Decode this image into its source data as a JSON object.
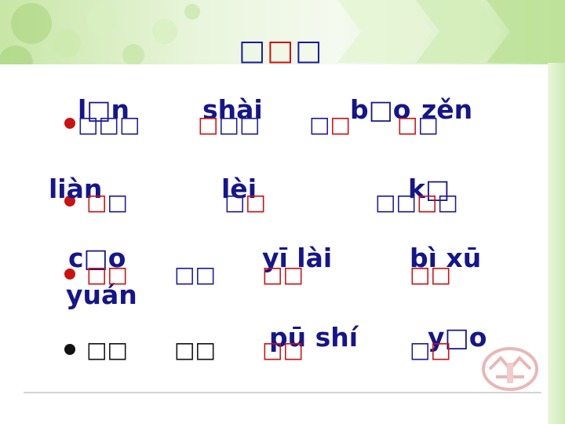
{
  "title": {
    "c1": "□",
    "c2": "□",
    "c3": "□"
  },
  "rows": [
    {
      "pinyin": [
        "l□n",
        "shài",
        "b□o",
        "zěn"
      ],
      "hanzi": [
        [
          {
            "t": "□",
            "c": "blue"
          },
          {
            "t": "□",
            "c": "blue"
          },
          {
            "t": "□",
            "c": "blue"
          }
        ],
        [
          {
            "t": "□",
            "c": "red"
          },
          {
            "t": "□",
            "c": "blue"
          },
          {
            "t": "□",
            "c": "blue"
          }
        ],
        [
          {
            "t": "□",
            "c": "blue"
          },
          {
            "t": "□",
            "c": "red"
          }
        ],
        [
          {
            "t": "□",
            "c": "red"
          },
          {
            "t": "□",
            "c": "blue"
          }
        ]
      ]
    },
    {
      "pinyin": [
        "liàn",
        "lèi",
        "k□"
      ],
      "hanzi": [
        [
          {
            "t": "□",
            "c": "red"
          },
          {
            "t": "□",
            "c": "blue"
          }
        ],
        [
          {
            "t": "□",
            "c": "blue"
          },
          {
            "t": "□",
            "c": "red"
          }
        ],
        [
          {
            "t": "□",
            "c": "blue"
          },
          {
            "t": "□",
            "c": "blue"
          },
          {
            "t": "□",
            "c": "red"
          },
          {
            "t": "□",
            "c": "blue"
          }
        ]
      ]
    },
    {
      "pinyin": [
        "c□o",
        "yuán",
        "yī lài",
        "bì xū"
      ],
      "hanzi": [
        [
          {
            "t": "□",
            "c": "red"
          },
          {
            "t": "□",
            "c": "red"
          }
        ],
        [
          {
            "t": "□",
            "c": "blue"
          },
          {
            "t": "□",
            "c": "blue"
          }
        ],
        [
          {
            "t": "□",
            "c": "red"
          },
          {
            "t": "□",
            "c": "red"
          }
        ],
        [
          {
            "t": "□",
            "c": "red"
          },
          {
            "t": "□",
            "c": "red"
          }
        ]
      ]
    },
    {
      "pinyin": [
        "pū shí",
        "y□o"
      ],
      "hanzi": [
        [
          {
            "t": "□",
            "c": "black"
          },
          {
            "t": "□",
            "c": "black"
          }
        ],
        [
          {
            "t": "□",
            "c": "black"
          },
          {
            "t": "□",
            "c": "black"
          }
        ],
        [
          {
            "t": "□",
            "c": "red"
          },
          {
            "t": "□",
            "c": "red"
          }
        ],
        [
          {
            "t": "□",
            "c": "blue"
          },
          {
            "t": "□",
            "c": "red"
          }
        ]
      ]
    }
  ],
  "colors": {
    "blue": "#1a1aa0",
    "red": "#cc1111",
    "pinyin": "#15158c"
  }
}
